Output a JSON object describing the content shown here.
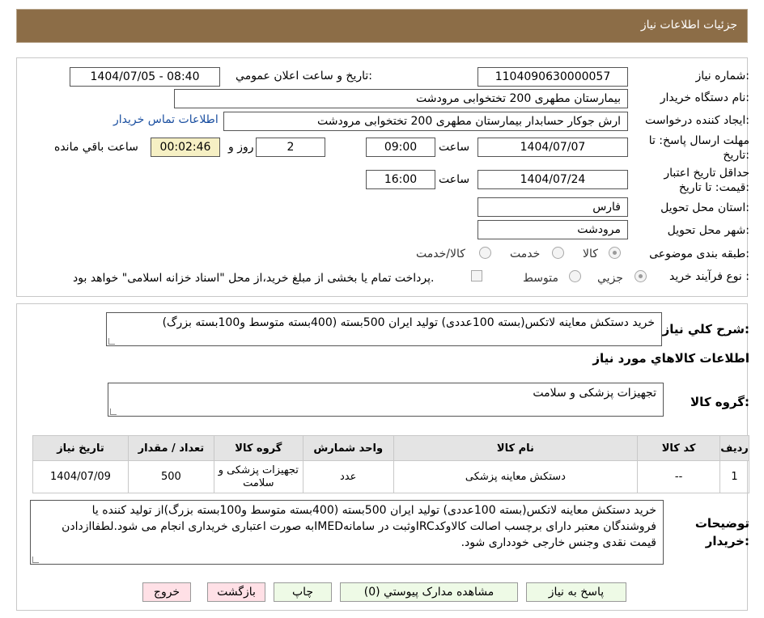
{
  "header": {
    "title": "جزئيات اطلاعات نياز"
  },
  "form": {
    "need_number_label": "شماره نياز:",
    "need_number": "1104090630000057",
    "announce_label": "تاريخ و ساعت اعلان عمومي:",
    "announce_value": "1404/07/05 - 08:40",
    "buyer_org_label": "نام دستگاه خريدار:",
    "buyer_org": "بيمارستان مطهری  200 تختخوابی مرودشت",
    "requester_label": "ايجاد کننده درخواست:",
    "requester": "ارش  جوکار حسابدار بيمارستان مطهری  200 تختخوابی مرودشت",
    "contact_link": "اطلاعات تماس خريدار",
    "deadline_label": "مهلت ارسال پاسخ: تا تاريخ:",
    "deadline_date": "1404/07/07",
    "time_label": "ساعت",
    "deadline_time": "09:00",
    "days_value": "2",
    "days_label": "روز و",
    "remaining_time": "00:02:46",
    "remaining_label": "ساعت باقي مانده",
    "validity_label": "حداقل تاريخ اعتبار قيمت: تا تاريخ:",
    "validity_date": "1404/07/24",
    "validity_time": "16:00",
    "province_label": "استان محل تحويل:",
    "province": "فارس",
    "city_label": "شهر محل تحويل:",
    "city": "مرودشت",
    "category_label": "طبقه بندی موضوعی:",
    "category_options": [
      "کالا",
      "خدمت",
      "کالا/خدمت"
    ],
    "category_selected": "کالا",
    "process_label": "نوع فرآيند خريد :",
    "process_options": [
      "جزيي",
      "متوسط"
    ],
    "process_selected": "جزيي",
    "payment_note": "پرداخت تمام يا بخشی از مبلغ خريد،از محل \"اسناد خزانه اسلامی\" خواهد بود."
  },
  "need": {
    "summary_label": "شرح کلي نياز:",
    "summary": "خريد دستکش معاينه لاتکس(بسته 100عددی) توليد ايران 500بسته (400بسته متوسط و100بسته بزرگ)",
    "goods_info_title": "اطلاعات کالاهاي مورد نياز",
    "goods_group_label": "گروه کالا:",
    "goods_group": "تجهيزات پزشکی و سلامت"
  },
  "table": {
    "headers": [
      "رديف",
      "کد کالا",
      "نام کالا",
      "واحد شمارش",
      "گروه کالا",
      "تعداد / مقدار",
      "تاريخ نياز"
    ],
    "rows": [
      [
        "1",
        "--",
        "دستکش معاينه پزشکی",
        "عدد",
        "تجهيزات پزشکی و سلامت",
        "500",
        "1404/07/09"
      ]
    ]
  },
  "buyer_notes": {
    "label": "توضيحات خريدار:",
    "text": "خريد دستکش معاينه لاتکس(بسته 100عددی) توليد ايران 500بسته (400بسته متوسط و100بسته بزرگ)از توليد کننده يا فروشندگان معتبر دارای برچسب اصالت کالاوکدIRCوثبت در سامانهIMEDبه صورت اعتباری خريداری انجام می شود.لطفاازدادن قيمت نقدی وجنس خارجی خودداری شود."
  },
  "buttons": {
    "reply": "پاسخ به نياز",
    "attachments": "مشاهده مدارک پيوستي (0)",
    "print": "چاپ",
    "back": "بازگشت",
    "exit": "خروج"
  },
  "colors": {
    "header_bg": "#8c6d47",
    "link": "#1a4fa0",
    "timer_bg": "#f6f0c4"
  }
}
